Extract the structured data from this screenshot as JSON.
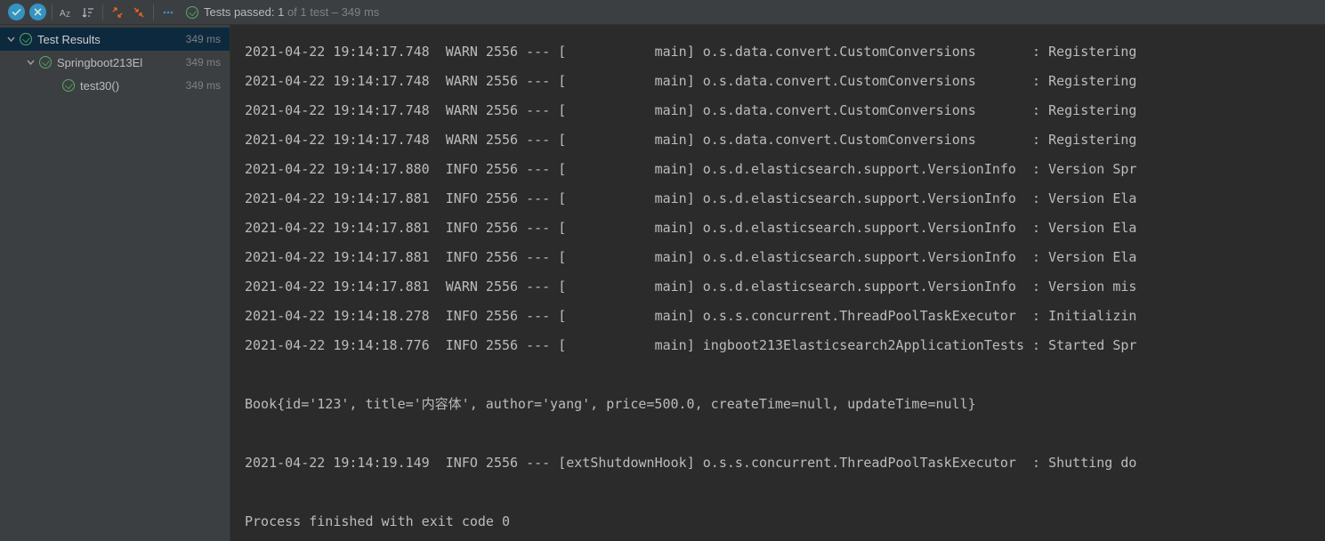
{
  "toolbar": {
    "status_prefix": "Tests passed: 1",
    "status_suffix": " of 1 test – 349 ms"
  },
  "tree": {
    "root": {
      "label": "Test Results",
      "duration": "349 ms"
    },
    "child1": {
      "label": "Springboot213El",
      "duration": "349 ms"
    },
    "child2": {
      "label": "test30()",
      "duration": "349 ms"
    }
  },
  "log_lines": [
    "2021-04-22 19:14:17.748  WARN 2556 --- [           main] o.s.data.convert.CustomConversions       : Registering",
    "2021-04-22 19:14:17.748  WARN 2556 --- [           main] o.s.data.convert.CustomConversions       : Registering",
    "2021-04-22 19:14:17.748  WARN 2556 --- [           main] o.s.data.convert.CustomConversions       : Registering",
    "2021-04-22 19:14:17.748  WARN 2556 --- [           main] o.s.data.convert.CustomConversions       : Registering",
    "2021-04-22 19:14:17.880  INFO 2556 --- [           main] o.s.d.elasticsearch.support.VersionInfo  : Version Spr",
    "2021-04-22 19:14:17.881  INFO 2556 --- [           main] o.s.d.elasticsearch.support.VersionInfo  : Version Ela",
    "2021-04-22 19:14:17.881  INFO 2556 --- [           main] o.s.d.elasticsearch.support.VersionInfo  : Version Ela",
    "2021-04-22 19:14:17.881  INFO 2556 --- [           main] o.s.d.elasticsearch.support.VersionInfo  : Version Ela",
    "2021-04-22 19:14:17.881  WARN 2556 --- [           main] o.s.d.elasticsearch.support.VersionInfo  : Version mis",
    "2021-04-22 19:14:18.278  INFO 2556 --- [           main] o.s.s.concurrent.ThreadPoolTaskExecutor  : Initializin",
    "2021-04-22 19:14:18.776  INFO 2556 --- [           main] ingboot213Elasticsearch2ApplicationTests : Started Spr",
    "",
    "Book{id='123', title='内容体', author='yang', price=500.0, createTime=null, updateTime=null}",
    "",
    "2021-04-22 19:14:19.149  INFO 2556 --- [extShutdownHook] o.s.s.concurrent.ThreadPoolTaskExecutor  : Shutting do",
    "",
    "Process finished with exit code 0"
  ]
}
